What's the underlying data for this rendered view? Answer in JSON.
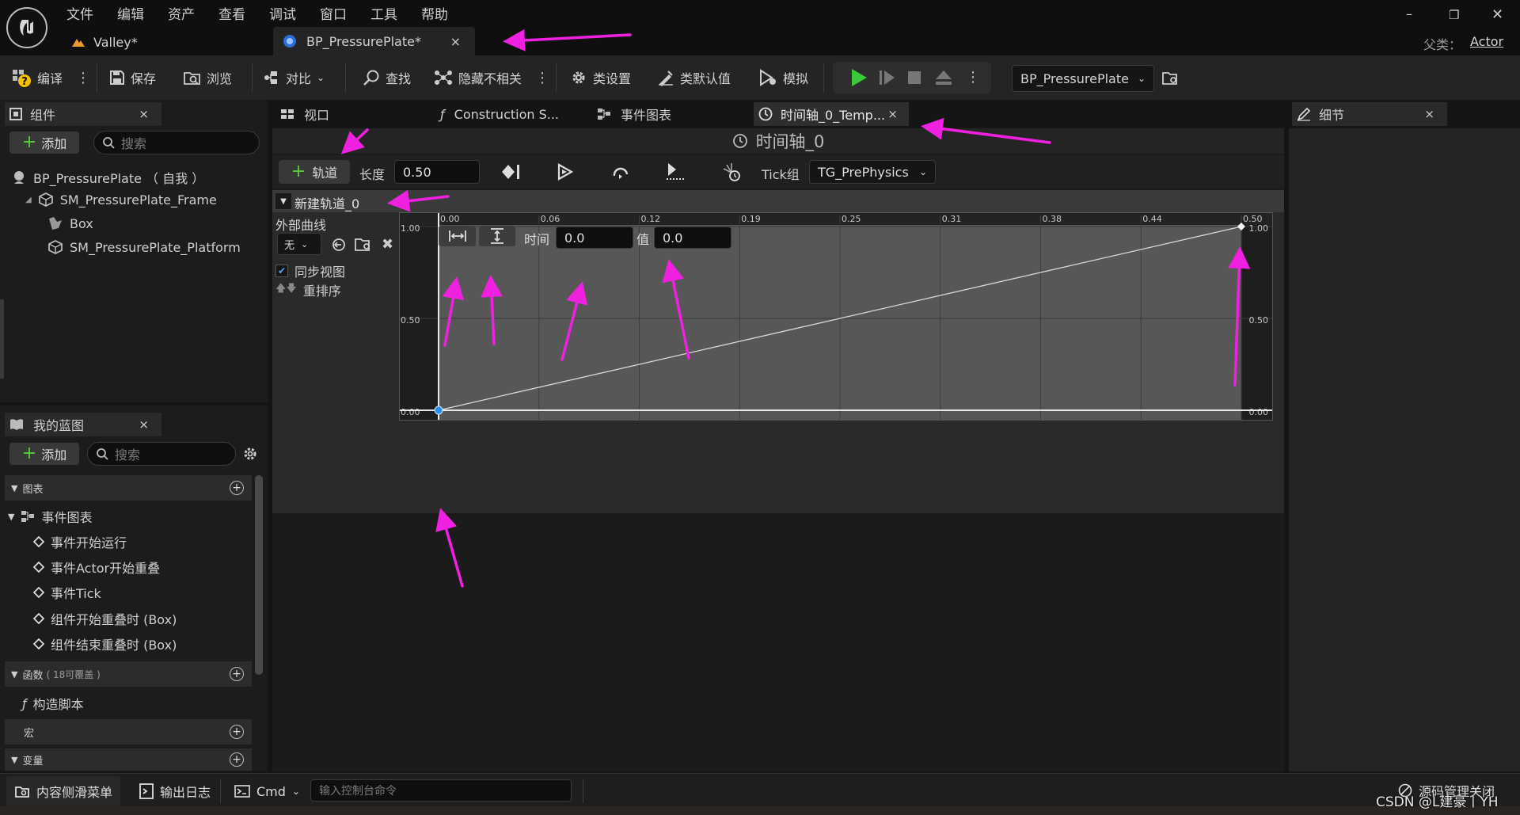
{
  "menu": [
    "文件",
    "编辑",
    "资产",
    "查看",
    "调试",
    "窗口",
    "工具",
    "帮助"
  ],
  "doc_tabs": [
    {
      "label": "Valley*"
    },
    {
      "label": "BP_PressurePlate*",
      "close": "×"
    }
  ],
  "parent_class": {
    "label": "父类：",
    "value": "Actor"
  },
  "window_controls": {
    "minimize": "–",
    "restore": "❐",
    "close": "✕"
  },
  "toolbar": {
    "compile": "编译",
    "save": "保存",
    "browse": "浏览",
    "diff": "对比",
    "find": "查找",
    "hide_unrelated": "隐藏不相关",
    "class_settings": "类设置",
    "class_defaults": "类默认值",
    "simulate": "模拟",
    "debug_object": "BP_PressurePlate"
  },
  "components_panel": {
    "title": "组件",
    "add": "添加",
    "search_placeholder": "搜索",
    "items": [
      "BP_PressurePlate （ 自我 ）",
      "SM_PressurePlate_Frame",
      "Box",
      "SM_PressurePlate_Platform"
    ]
  },
  "my_blueprint": {
    "title": "我的蓝图",
    "add": "添加",
    "search_placeholder": "搜索",
    "graphs_label": "图表",
    "event_graph": "事件图表",
    "events": [
      "事件开始运行",
      "事件Actor开始重叠",
      "事件Tick",
      "组件开始重叠时 (Box)",
      "组件结束重叠时 (Box)"
    ],
    "functions_label": "函数",
    "functions_count": "( 18可覆盖 )",
    "construction_script": "构造脚本",
    "macros_label": "宏",
    "variables_label": "变量"
  },
  "editor_tabs": [
    {
      "label": "视口"
    },
    {
      "label": "Construction S..."
    },
    {
      "label": "事件图表"
    },
    {
      "label": "时间轴_0_Temp...",
      "close": "×"
    }
  ],
  "details_panel": {
    "title": "细节"
  },
  "timeline": {
    "title": "时间轴_0",
    "add_track": "轨道",
    "length_label": "长度",
    "length_value": "0.50",
    "tick_group_label": "Tick组",
    "tick_group_value": "TG_PrePhysics",
    "track_name": "新建轨道_0",
    "external_curve_label": "外部曲线",
    "external_curve_value": "无",
    "sync_view": "同步视图",
    "reorder": "重排序",
    "time_label": "时间",
    "time_value": "0.0",
    "value_label": "值",
    "value_value": "0.0",
    "x_ticks": [
      "0.00",
      "0.06",
      "0.12",
      "0.19",
      "0.25",
      "0.31",
      "0.38",
      "0.44",
      "0.50"
    ],
    "y_ticks_left": [
      "1.00",
      "0.50",
      "0.00"
    ],
    "y_ticks_right": [
      "1.00",
      "0.50",
      "0.00"
    ],
    "keys": [
      {
        "time": 0.0,
        "value": 0.0
      },
      {
        "time": 0.5,
        "value": 1.0
      }
    ],
    "x_range": [
      0.0,
      0.5
    ],
    "y_range": [
      0.0,
      1.0
    ]
  },
  "statusbar": {
    "content_drawer": "内容侧滑菜单",
    "output_log": "输出日志",
    "cmd": "Cmd",
    "console_placeholder": "输入控制台命令",
    "source_control": "源码管理关闭"
  },
  "watermark": "CSDN @L建豪丨YH",
  "colors": {
    "annotation_arrow": "#f020e0",
    "play_green": "#3cc83c",
    "key_blue": "#2a8ff0"
  }
}
